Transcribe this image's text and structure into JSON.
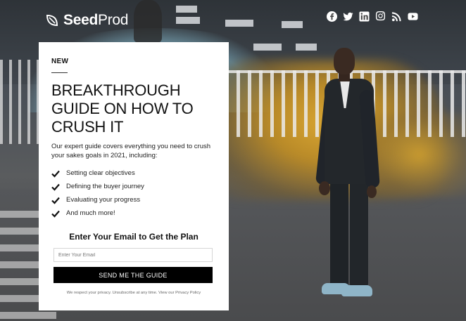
{
  "brand": {
    "name_bold": "Seed",
    "name_light": "Prod"
  },
  "social": [
    {
      "icon": "facebook-icon"
    },
    {
      "icon": "twitter-icon"
    },
    {
      "icon": "linkedin-icon"
    },
    {
      "icon": "instagram-icon"
    },
    {
      "icon": "rss-icon"
    },
    {
      "icon": "youtube-icon"
    }
  ],
  "card": {
    "eyebrow": "NEW",
    "headline": "BREAKTHROUGH GUIDE ON HOW TO CRUSH IT",
    "description": "Our expert guide covers everything you need to crush your sakes goals in 2021, including:",
    "checklist": [
      "Setting clear objectives",
      "Defining the buyer journey",
      "Evaluating your progress",
      "And much more!"
    ],
    "cta_heading": "Enter Your Email to Get the Plan",
    "email_placeholder": "Enter Your Email",
    "email_value": "",
    "submit_label": "SEND ME THE GUIDE",
    "privacy_text": "We respect your privacy. Unsubscribe at any time.",
    "privacy_link": "View our Privacy Policy"
  },
  "colors": {
    "accent": "#000000",
    "card_bg": "#ffffff",
    "text": "#111111"
  }
}
